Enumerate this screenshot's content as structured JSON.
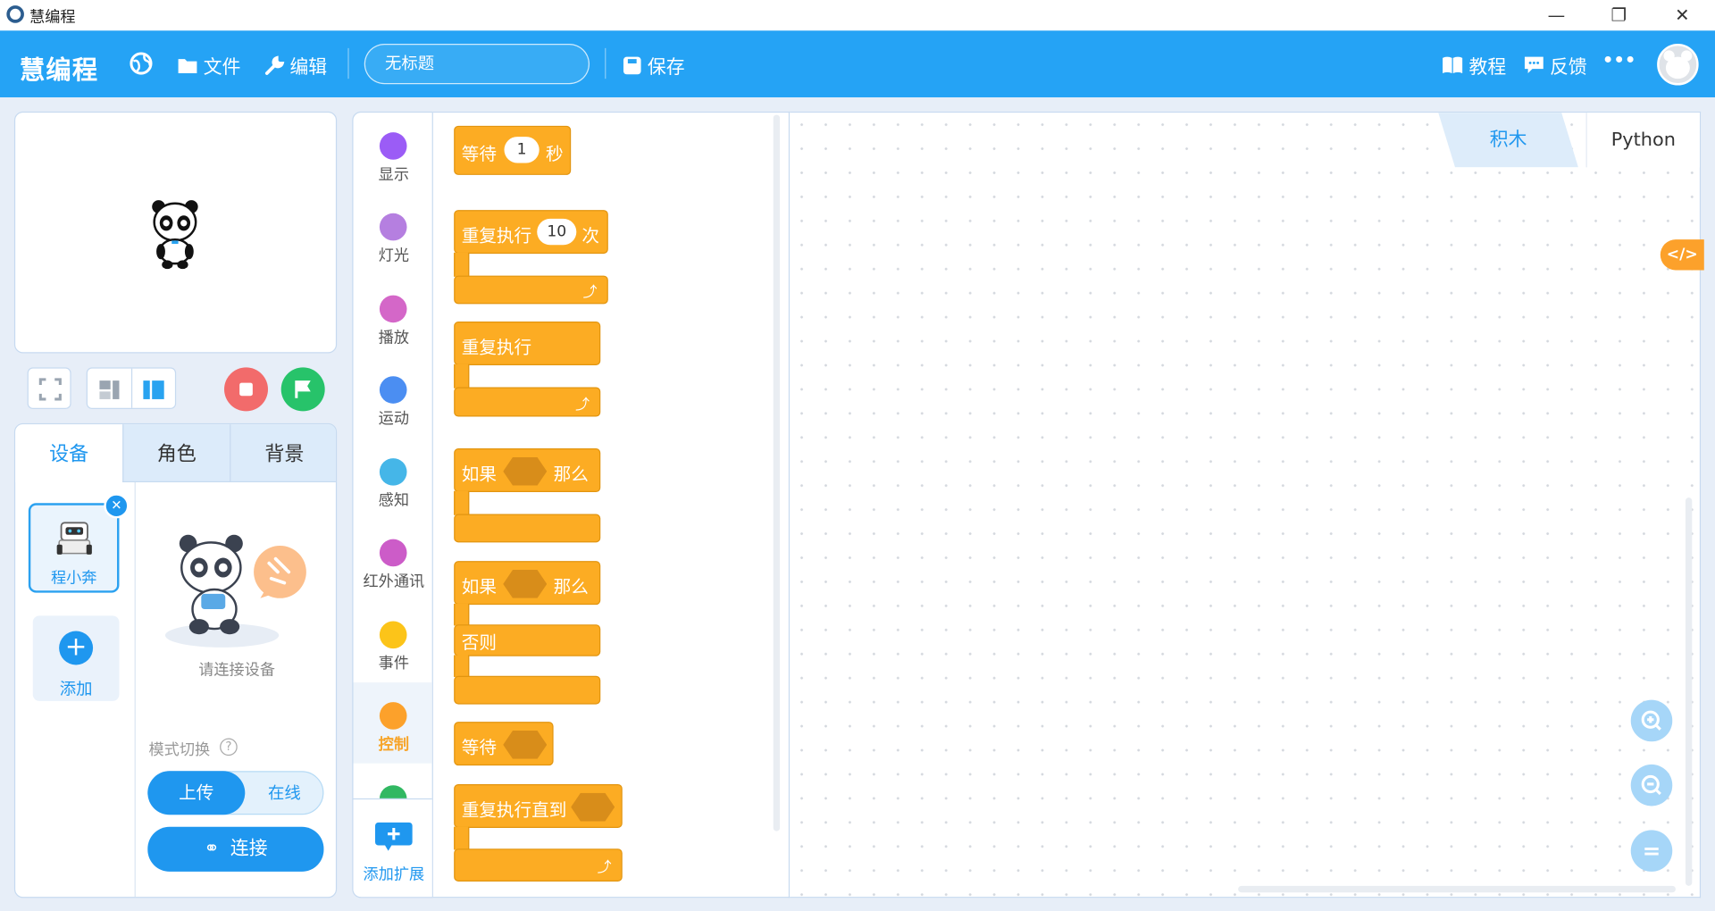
{
  "window": {
    "title": "慧编程",
    "minimize": "—",
    "restore": "❐",
    "close": "✕"
  },
  "menubar": {
    "brand": "慧编程",
    "file": "文件",
    "edit": "编辑",
    "project_title": "无标题",
    "save": "保存",
    "tutorial": "教程",
    "feedback": "反馈",
    "more": "•••"
  },
  "stage_controls": {
    "stop": "stop",
    "go": "flag"
  },
  "tabs": [
    "设备",
    "角色",
    "背景"
  ],
  "devices": {
    "device_name": "程小奔",
    "remove": "✕",
    "add_label": "添加",
    "add_icon": "+"
  },
  "connect_panel": {
    "hint": "请连接设备",
    "mode_label": "模式切换",
    "help": "?",
    "mode_upload": "上传",
    "mode_online": "在线",
    "connect": "连接"
  },
  "categories": [
    {
      "label": "显示",
      "color": "#9b5cf6"
    },
    {
      "label": "灯光",
      "color": "#b57fe0"
    },
    {
      "label": "播放",
      "color": "#d467c8"
    },
    {
      "label": "运动",
      "color": "#4b8ef2"
    },
    {
      "label": "感知",
      "color": "#45b6e8"
    },
    {
      "label": "红外通讯",
      "color": "#cc5cc8"
    },
    {
      "label": "事件",
      "color": "#fcc419"
    },
    {
      "label": "控制",
      "color": "#fca12b"
    }
  ],
  "add_extension": "添加扩展",
  "blocks": {
    "wait_label": "等待",
    "wait_value": "1",
    "wait_unit": "秒",
    "repeat_label": "重复执行",
    "repeat_value": "10",
    "repeat_unit": "次",
    "forever_label": "重复执行",
    "if_label": "如果",
    "then_label": "那么",
    "if2_label": "如果",
    "then2_label": "那么",
    "else_label": "否则",
    "waituntil_label": "等待",
    "repeatuntil_label": "重复执行直到",
    "loop_arrow": "⤴"
  },
  "code_tabs": {
    "blocks": "积木",
    "python": "Python"
  },
  "code_toggle": "</>",
  "zoom": {
    "in": "+",
    "out": "−",
    "reset": "="
  }
}
